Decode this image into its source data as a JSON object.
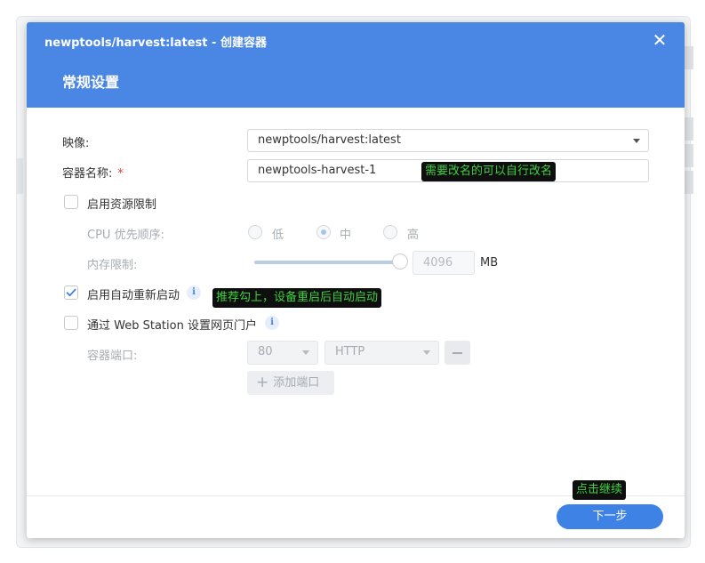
{
  "dialog": {
    "title": "newptools/harvest:latest - 创建容器",
    "close_glyph": "✕",
    "section_title": "常规设置"
  },
  "form": {
    "image_label": "映像:",
    "image_value": "newptools/harvest:latest",
    "name_label": "容器名称:",
    "name_required": "*",
    "name_value": "newptools-harvest-1",
    "resource_limit_label": "启用资源限制",
    "resource_limit_checked": false,
    "cpu_priority_label": "CPU 优先顺序:",
    "cpu_options": [
      "低",
      "中",
      "高"
    ],
    "cpu_selected": "中",
    "memory_label": "内存限制:",
    "memory_value": "4096",
    "memory_unit": "MB",
    "auto_restart_label": "启用自动重新启动",
    "auto_restart_checked": true,
    "web_station_label": "通过 Web Station 设置网页门户",
    "web_station_checked": false,
    "port_label": "容器端口:",
    "port_value": "80",
    "protocol_value": "HTTP",
    "add_port_label": "添加端口",
    "info_glyph": "i"
  },
  "annotations": {
    "rename_hint": "需要改名的可以自行改名",
    "restart_hint": "推荐勾上，设备重启后自动启动",
    "continue_hint": "点击继续"
  },
  "footer": {
    "next_label": "下一步"
  },
  "colors": {
    "header_blue": "#4a86e3",
    "primary_button": "#3f82e6",
    "annotation_bg": "#0f0f0f",
    "annotation_text": "#3fd13f",
    "required_star": "#e0412f"
  },
  "icons": {
    "close": "close-icon",
    "check": "checkmark-icon",
    "info": "info-icon",
    "dropdown": "chevron-down-icon",
    "plus": "plus-icon",
    "minus": "minus-icon"
  }
}
